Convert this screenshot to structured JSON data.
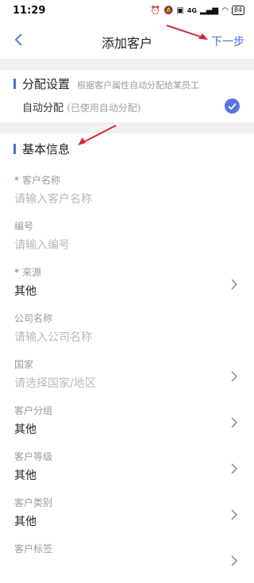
{
  "status_bar": {
    "time": "11:29",
    "network": "4G",
    "battery": "84"
  },
  "nav": {
    "title": "添加客户",
    "next_label": "下一步"
  },
  "assign": {
    "title": "分配设置",
    "hint": "根据客户属性自动分配给某员工",
    "auto_label": "自动分配",
    "auto_hint": "(已使用自动分配)",
    "checked": true
  },
  "basic": {
    "title": "基本信息"
  },
  "fields": [
    {
      "label": "客户名称",
      "required": true,
      "value": "请输入客户名称",
      "is_placeholder": true,
      "has_chevron": false
    },
    {
      "label": "编号",
      "required": false,
      "value": "请输入编号",
      "is_placeholder": true,
      "has_chevron": false
    },
    {
      "label": "来源",
      "required": true,
      "value": "其他",
      "is_placeholder": false,
      "has_chevron": true
    },
    {
      "label": "公司名称",
      "required": false,
      "value": "请输入公司名称",
      "is_placeholder": true,
      "has_chevron": false
    },
    {
      "label": "国家",
      "required": false,
      "value": "请选择国家/地区",
      "is_placeholder": true,
      "has_chevron": true
    },
    {
      "label": "客户分组",
      "required": false,
      "value": "其他",
      "is_placeholder": false,
      "has_chevron": true
    },
    {
      "label": "客户等级",
      "required": false,
      "value": "其他",
      "is_placeholder": false,
      "has_chevron": true
    },
    {
      "label": "客户类别",
      "required": false,
      "value": "其他",
      "is_placeholder": false,
      "has_chevron": true
    },
    {
      "label": "客户标签",
      "required": false,
      "value": "",
      "is_placeholder": false,
      "has_chevron": true
    }
  ],
  "colors": {
    "accent": "#4a6fd6",
    "annotation_arrow": "#d8283a",
    "required": "#e05a5a"
  }
}
